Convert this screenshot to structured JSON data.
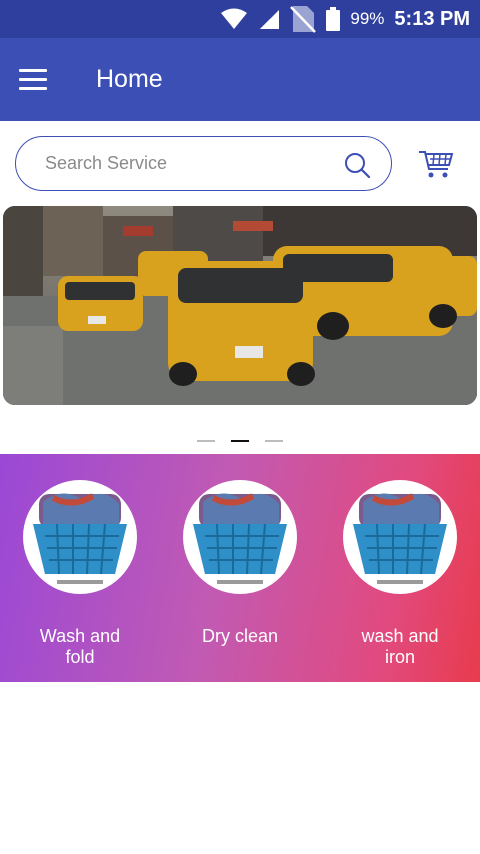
{
  "status_bar": {
    "battery": "99%",
    "time": "5:13 PM",
    "icons": [
      "wifi-icon",
      "signal-icon",
      "no-sim-icon",
      "battery-icon"
    ]
  },
  "app_bar": {
    "title": "Home",
    "menu_icon": "hamburger-menu-icon"
  },
  "search": {
    "placeholder": "Search Service",
    "icon": "search-icon"
  },
  "cart": {
    "icon": "shopping-cart-icon"
  },
  "banner": {
    "pagination": {
      "count": 3,
      "active_index": 1
    }
  },
  "services": [
    {
      "label": "Wash and fold",
      "image": "laundry-basket"
    },
    {
      "label": "Dry clean",
      "image": "laundry-basket"
    },
    {
      "label": "wash and iron",
      "image": "laundry-basket"
    }
  ],
  "colors": {
    "status_bar": "#2f3f9e",
    "app_bar": "#3c4fb5",
    "gradient_start": "#9a48d6",
    "gradient_end": "#e83b4d"
  }
}
